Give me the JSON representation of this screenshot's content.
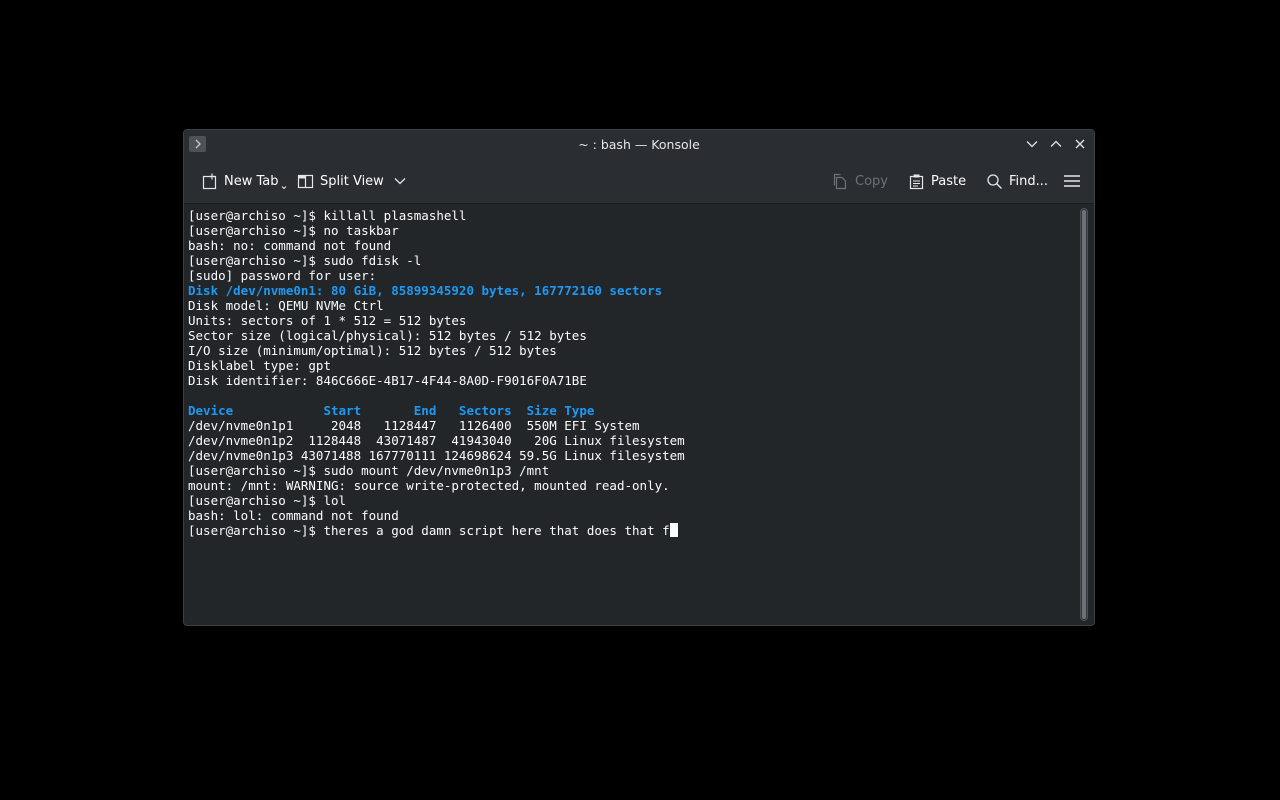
{
  "window": {
    "title": "~ : bash — Konsole"
  },
  "toolbar": {
    "new_tab_label": "New Tab",
    "split_view_label": "Split View",
    "copy_label": "Copy",
    "paste_label": "Paste",
    "find_label": "Find..."
  },
  "terminal": {
    "lines": [
      {
        "text": "[user@archiso ~]$ killall plasmashell",
        "highlight": false
      },
      {
        "text": "[user@archiso ~]$ no taskbar",
        "highlight": false
      },
      {
        "text": "bash: no: command not found",
        "highlight": false
      },
      {
        "text": "[user@archiso ~]$ sudo fdisk -l",
        "highlight": false
      },
      {
        "text": "[sudo] password for user:",
        "highlight": false
      },
      {
        "text": "Disk /dev/nvme0n1: 80 GiB, 85899345920 bytes, 167772160 sectors",
        "highlight": true
      },
      {
        "text": "Disk model: QEMU NVMe Ctrl",
        "highlight": false
      },
      {
        "text": "Units: sectors of 1 * 512 = 512 bytes",
        "highlight": false
      },
      {
        "text": "Sector size (logical/physical): 512 bytes / 512 bytes",
        "highlight": false
      },
      {
        "text": "I/O size (minimum/optimal): 512 bytes / 512 bytes",
        "highlight": false
      },
      {
        "text": "Disklabel type: gpt",
        "highlight": false
      },
      {
        "text": "Disk identifier: 846C666E-4B17-4F44-8A0D-F9016F0A71BE",
        "highlight": false
      },
      {
        "text": "",
        "highlight": false
      },
      {
        "text": "Device            Start       End   Sectors  Size Type",
        "highlight": true
      },
      {
        "text": "/dev/nvme0n1p1     2048   1128447   1126400  550M EFI System",
        "highlight": false
      },
      {
        "text": "/dev/nvme0n1p2  1128448  43071487  41943040   20G Linux filesystem",
        "highlight": false
      },
      {
        "text": "/dev/nvme0n1p3 43071488 167770111 124698624 59.5G Linux filesystem",
        "highlight": false
      },
      {
        "text": "[user@archiso ~]$ sudo mount /dev/nvme0n1p3 /mnt",
        "highlight": false
      },
      {
        "text": "mount: /mnt: WARNING: source write-protected, mounted read-only.",
        "highlight": false
      },
      {
        "text": "[user@archiso ~]$ lol",
        "highlight": false
      },
      {
        "text": "bash: lol: command not found",
        "highlight": false
      }
    ],
    "current_line": "[user@archiso ~]$ theres a god damn script here that does that f"
  },
  "icons": {
    "app_menu": "chevron-right-icon",
    "new_tab": "new-tab-icon",
    "split_view": "split-view-icon",
    "copy": "copy-icon",
    "paste": "paste-icon",
    "find": "search-icon",
    "hamburger": "hamburger-menu-icon",
    "minimize": "chevron-down-icon",
    "maximize": "chevron-up-icon",
    "close": "close-icon"
  },
  "colors": {
    "background": "#000000",
    "window": "#232629",
    "titlebar": "#2a2e32",
    "text": "#fcfcfc",
    "highlight": "#1d99f3"
  }
}
